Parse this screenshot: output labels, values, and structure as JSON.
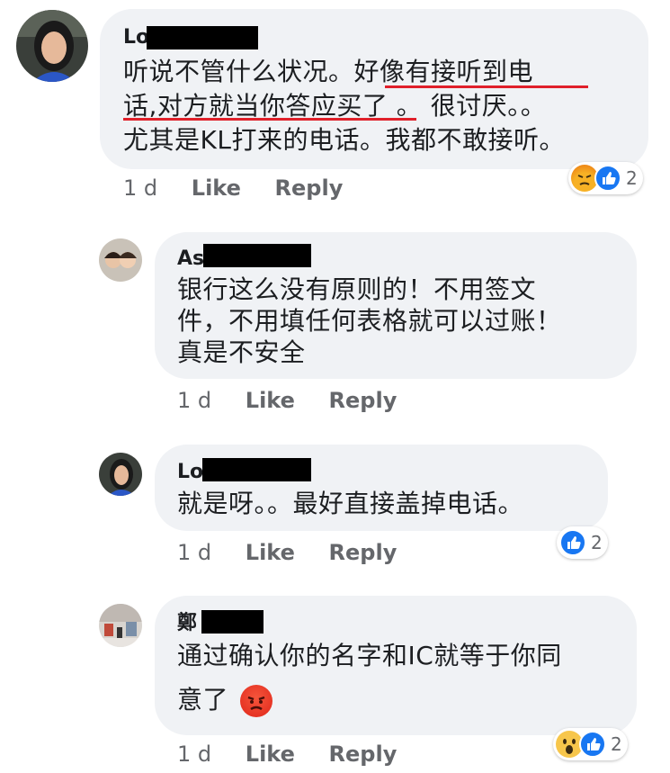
{
  "comments": [
    {
      "author_visible": "Lo",
      "lines": [
        "听说不管什么状况。好像有接听到电",
        "话,对方就当你答应买了 。 很讨厌。。",
        "尤其是KL打来的电话。我都不敢接听。"
      ],
      "time": "1 d",
      "like_label": "Like",
      "reply_label": "Reply",
      "reactions": [
        "angry-emoji",
        "like-emoji"
      ],
      "reaction_count": "2"
    },
    {
      "author_visible": "As",
      "lines": [
        "银行这么没有原则的！不用签文",
        "件，不用填任何表格就可以过账！",
        "真是不安全"
      ],
      "time": "1 d",
      "like_label": "Like",
      "reply_label": "Reply"
    },
    {
      "author_visible": "Lo",
      "lines": [
        "就是呀。。最好直接盖掉电话。"
      ],
      "time": "1 d",
      "like_label": "Like",
      "reply_label": "Reply",
      "reactions": [
        "like-emoji"
      ],
      "reaction_count": "2"
    },
    {
      "author_visible": "鄭",
      "lines": [
        "通过确认你的名字和IC就等于你同",
        "意了"
      ],
      "inline_emoji": "pouting-face-emoji",
      "time": "1 d",
      "like_label": "Like",
      "reply_label": "Reply",
      "reactions": [
        "wow-emoji",
        "like-emoji"
      ],
      "reaction_count": "2"
    }
  ],
  "colors": {
    "bubble": "#f0f2f5",
    "like_blue": "#1877f2",
    "underline_red": "#e0202a",
    "meta_gray": "#65676b"
  }
}
